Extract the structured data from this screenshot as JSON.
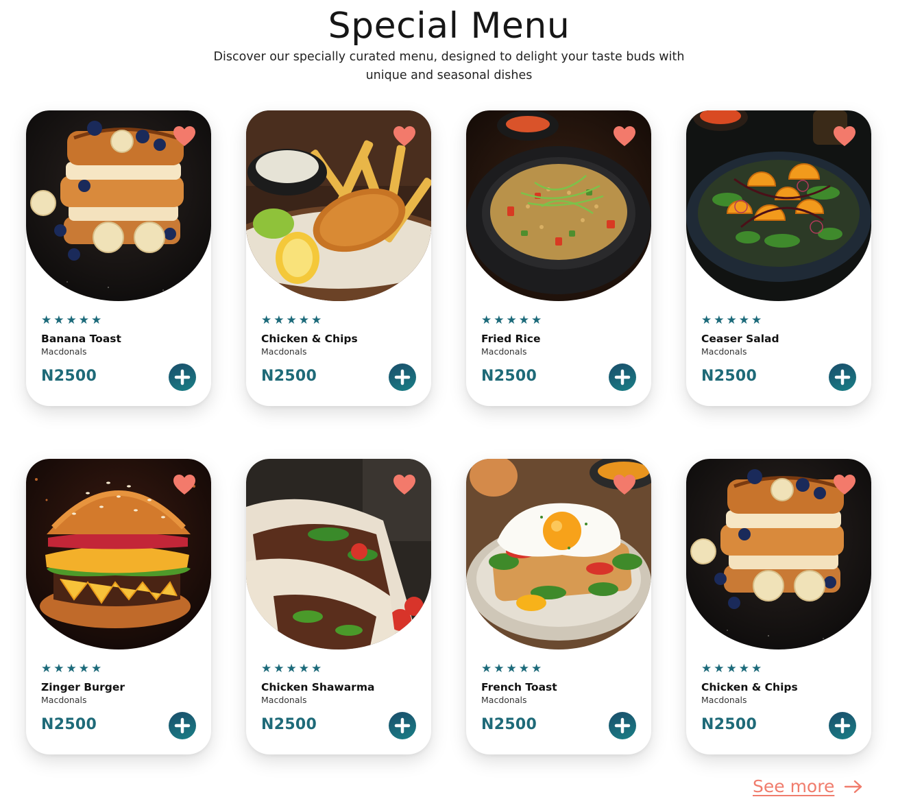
{
  "header": {
    "title": "Special Menu",
    "subtitle": "Discover our specially curated menu, designed to delight your taste buds with unique and seasonal dishes"
  },
  "colors": {
    "accent_teal": "#1e6a78",
    "heart_coral": "#f37a6b",
    "see_more_coral": "#f07c6c"
  },
  "menu": {
    "items": [
      {
        "name": "Banana Toast",
        "restaurant": "Macdonals",
        "price": "N2500",
        "rating": 5,
        "stars": "★★★★★",
        "image": "banana-toast"
      },
      {
        "name": "Chicken & Chips",
        "restaurant": "Macdonals",
        "price": "N2500",
        "rating": 5,
        "stars": "★★★★★",
        "image": "fish-and-chips"
      },
      {
        "name": "Fried Rice",
        "restaurant": "Macdonals",
        "price": "N2500",
        "rating": 5,
        "stars": "★★★★★",
        "image": "fried-rice"
      },
      {
        "name": "Ceaser Salad",
        "restaurant": "Macdonals",
        "price": "N2500",
        "rating": 5,
        "stars": "★★★★★",
        "image": "salad"
      },
      {
        "name": "Zinger Burger",
        "restaurant": "Macdonals",
        "price": "N2500",
        "rating": 5,
        "stars": "★★★★★",
        "image": "burger"
      },
      {
        "name": "Chicken Shawarma",
        "restaurant": "Macdonals",
        "price": "N2500",
        "rating": 5,
        "stars": "★★★★★",
        "image": "shawarma"
      },
      {
        "name": "French Toast",
        "restaurant": "Macdonals",
        "price": "N2500",
        "rating": 5,
        "stars": "★★★★★",
        "image": "egg-toast"
      },
      {
        "name": "Chicken & Chips",
        "restaurant": "Macdonals",
        "price": "N2500",
        "rating": 5,
        "stars": "★★★★★",
        "image": "banana-toast"
      }
    ]
  },
  "icons": {
    "favorite": "heart-icon",
    "add": "plus-icon",
    "see_more": "arrow-right-icon"
  },
  "footer": {
    "see_more_label": "See more"
  }
}
